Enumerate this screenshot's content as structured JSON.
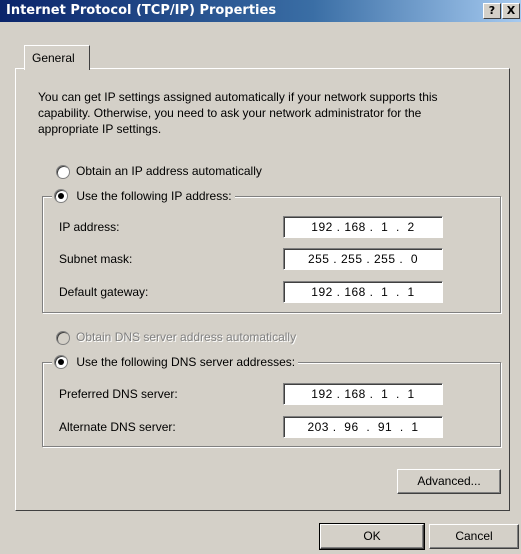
{
  "window": {
    "title": "Internet Protocol (TCP/IP) Properties",
    "help_label": "?",
    "close_label": "X"
  },
  "tabs": [
    {
      "label": "General",
      "selected": true
    }
  ],
  "description": "You can get IP settings assigned automatically if your network supports this capability. Otherwise, you need to ask your network administrator for the appropriate IP settings.",
  "ip": {
    "auto_label": "Obtain an IP address automatically",
    "manual_label": "Use the following IP address:",
    "selected": "manual",
    "fields": [
      {
        "label": "IP address:",
        "value": "192 . 168 .  1  .  2"
      },
      {
        "label": "Subnet mask:",
        "value": "255 . 255 . 255 .  0"
      },
      {
        "label": "Default gateway:",
        "value": "192 . 168 .  1  .  1"
      }
    ]
  },
  "dns": {
    "auto_label": "Obtain DNS server address automatically",
    "auto_enabled": false,
    "manual_label": "Use the following DNS server addresses:",
    "selected": "manual",
    "fields": [
      {
        "label": "Preferred DNS server:",
        "value": "192 . 168 .  1  .  1"
      },
      {
        "label": "Alternate DNS server:",
        "value": "203 .  96  .  91  .  1"
      }
    ]
  },
  "buttons": {
    "advanced": "Advanced...",
    "ok": "OK",
    "cancel": "Cancel"
  },
  "colors": {
    "titlebar_start": "#0a246a",
    "titlebar_end": "#a6caf0",
    "face": "#d4d0c8"
  }
}
